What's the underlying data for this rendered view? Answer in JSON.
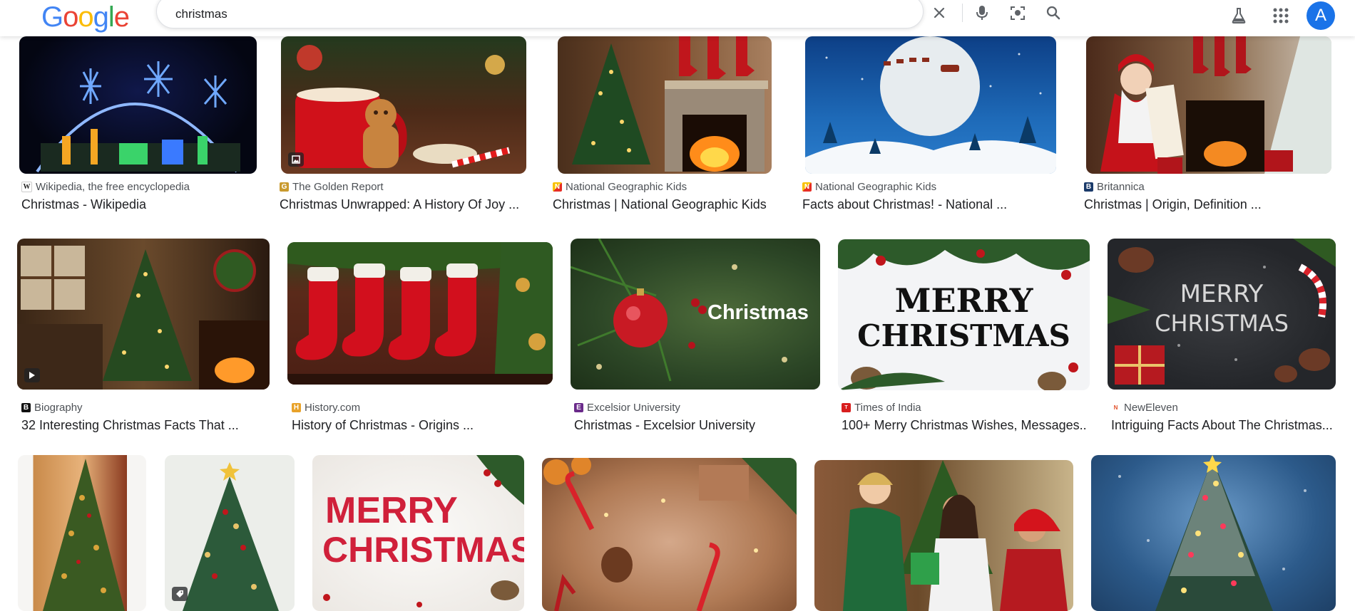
{
  "header": {
    "logo_letters": [
      "G",
      "o",
      "o",
      "g",
      "l",
      "e"
    ],
    "logo_colors": [
      "#4285f4",
      "#ea4335",
      "#fbbc05",
      "#4285f4",
      "#34a853",
      "#ea4335"
    ],
    "search_value": "christmas",
    "avatar_letter": "A"
  },
  "results": [
    {
      "source": "Wikipedia, the free encyclopedia",
      "title": "Christmas - Wikipedia",
      "favicon": "W"
    },
    {
      "source": "The Golden Report",
      "title": "Christmas Unwrapped: A History Of Joy ...",
      "favicon": "G"
    },
    {
      "source": "National Geographic Kids",
      "title": "Christmas | National Geographic Kids",
      "favicon": "N"
    },
    {
      "source": "National Geographic Kids",
      "title": "Facts about Christmas! - National ...",
      "favicon": "N"
    },
    {
      "source": "Britannica",
      "title": "Christmas | Origin, Definition ...",
      "favicon": "B"
    },
    {
      "source": "Biography",
      "title": "32 Interesting Christmas Facts That ...",
      "favicon": "B"
    },
    {
      "source": "History.com",
      "title": "History of Christmas - Origins ...",
      "favicon": "H"
    },
    {
      "source": "Excelsior University",
      "title": "Christmas - Excelsior University",
      "favicon": "E"
    },
    {
      "source": "Times of India",
      "title": "100+ Merry Christmas Wishes, Messages...",
      "favicon": "T"
    },
    {
      "source": "NewEleven",
      "title": "Intriguing Facts About The Christmas...",
      "favicon": "N"
    }
  ],
  "image_texts": {
    "excelsior": "Christmas",
    "toi_line1": "MERRY",
    "toi_line2": "CHRISTMAS",
    "neweleven_line1": "MERRY",
    "neweleven_line2": "CHRISTMAS",
    "row3_line1": "MERRY",
    "row3_line2": "CHRISTMAS"
  }
}
